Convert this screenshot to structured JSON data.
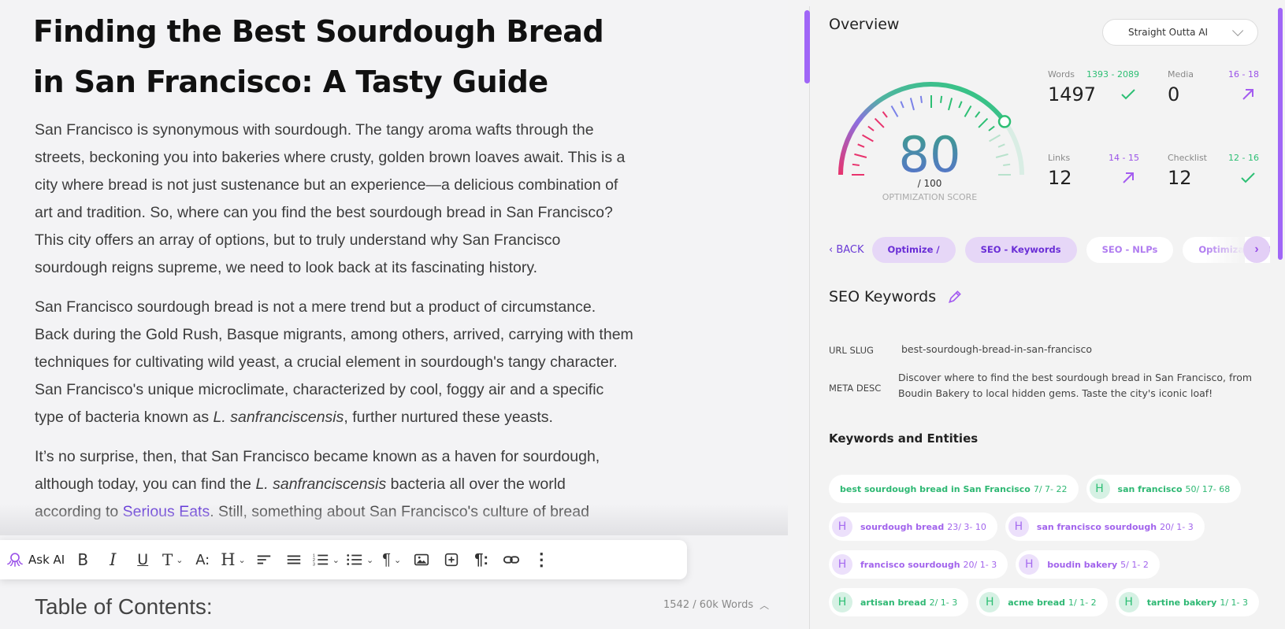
{
  "editor": {
    "title": "Finding the Best Sourdough Bread in San Francisco: A Tasty Guide",
    "paragraphs": {
      "p1": "San Francisco is synonymous with sourdough. The tangy aroma wafts through the streets, beckoning you into bakeries where crusty, golden brown loaves await. This is a city where bread is not just sustenance but an experience—a delicious combination of art and tradition. So, where can you find the best sourdough bread in San Francisco? This city offers an array of options, but to truly understand why San Francisco sourdough reigns supreme, we need to look back at its fascinating history.",
      "p2_before": "San Francisco sourdough bread is not a mere trend but a product of circumstance. Back during the Gold Rush, Basque migrants, among others, arrived, carrying with them techniques for cultivating wild yeast, a crucial element in sourdough's tangy character. San Francisco's unique microclimate, characterized by cool, foggy air and a specific type of bacteria known as ",
      "p2_italic": "L. sanfranciscensis",
      "p2_after": ", further nurtured these yeasts.",
      "p3_before": "It’s no surprise, then, that San Francisco became known as a haven for sourdough, although today, you can find the ",
      "p3_italic": "L. sanfranciscensis",
      "p3_mid": " bacteria all over the world according to ",
      "p3_link": "Serious Eats",
      "p3_after": ". Still, something about San Francisco's culture of bread"
    },
    "toc_heading": "Table of Contents:",
    "word_count": "1542 / 60k Words",
    "toolbar": {
      "ask_ai": "Ask AI"
    }
  },
  "panel": {
    "overview_title": "Overview",
    "dropdown_value": "Straight Outta AI",
    "score": {
      "value": "80",
      "max": "/ 100",
      "label": "OPTIMIZATION SCORE",
      "fraction": 0.8
    },
    "metrics": {
      "words": {
        "label": "Words",
        "range": "1393 - 2089",
        "value": "1497",
        "status": "check"
      },
      "media": {
        "label": "Media",
        "range": "16 - 18",
        "value": "0",
        "status": "arrow-up"
      },
      "links": {
        "label": "Links",
        "range": "14 - 15",
        "value": "12",
        "status": "arrow-up"
      },
      "checklist": {
        "label": "Checklist",
        "range": "12 - 16",
        "value": "12",
        "status": "check"
      }
    },
    "nav": {
      "back": "BACK",
      "tabs": [
        "Optimize /",
        "SEO - Keywords",
        "SEO - NLPs",
        "Optimization AI"
      ]
    },
    "seo_keywords_title": "SEO Keywords",
    "url_slug_label": "URL SLUG",
    "url_slug": "best-sourdough-bread-in-san-francisco",
    "meta_desc_label": "META DESC",
    "meta_desc": "Discover where to find the best sourdough bread in San Francisco, from Boudin Bakery to local hidden gems. Taste the city's iconic loaf!",
    "keywords_title": "Keywords and Entities",
    "keywords": [
      {
        "badge": "",
        "term": "best sourdough bread in San Francisco",
        "count": "7/ 7- 22",
        "color": "green"
      },
      {
        "badge": "H",
        "term": "san francisco",
        "count": "50/ 17- 68",
        "color": "green"
      },
      {
        "badge": "H",
        "term": "sourdough bread",
        "count": "23/ 3- 10",
        "color": "purple"
      },
      {
        "badge": "H",
        "term": "san francisco sourdough",
        "count": "20/ 1- 3",
        "color": "purple"
      },
      {
        "badge": "H",
        "term": "francisco sourdough",
        "count": "20/ 1- 3",
        "color": "purple"
      },
      {
        "badge": "H",
        "term": "boudin bakery",
        "count": "5/ 1- 2",
        "color": "purple"
      },
      {
        "badge": "H",
        "term": "artisan bread",
        "count": "2/ 1- 3",
        "color": "green"
      },
      {
        "badge": "H",
        "term": "acme bread",
        "count": "1/ 1- 2",
        "color": "green"
      },
      {
        "badge": "H",
        "term": "tartine bakery",
        "count": "1/ 1- 3",
        "color": "green"
      }
    ],
    "colors": {
      "accent_purple": "#9a52e8",
      "success_green": "#2dbf74",
      "score_red": "#e8336d"
    }
  }
}
